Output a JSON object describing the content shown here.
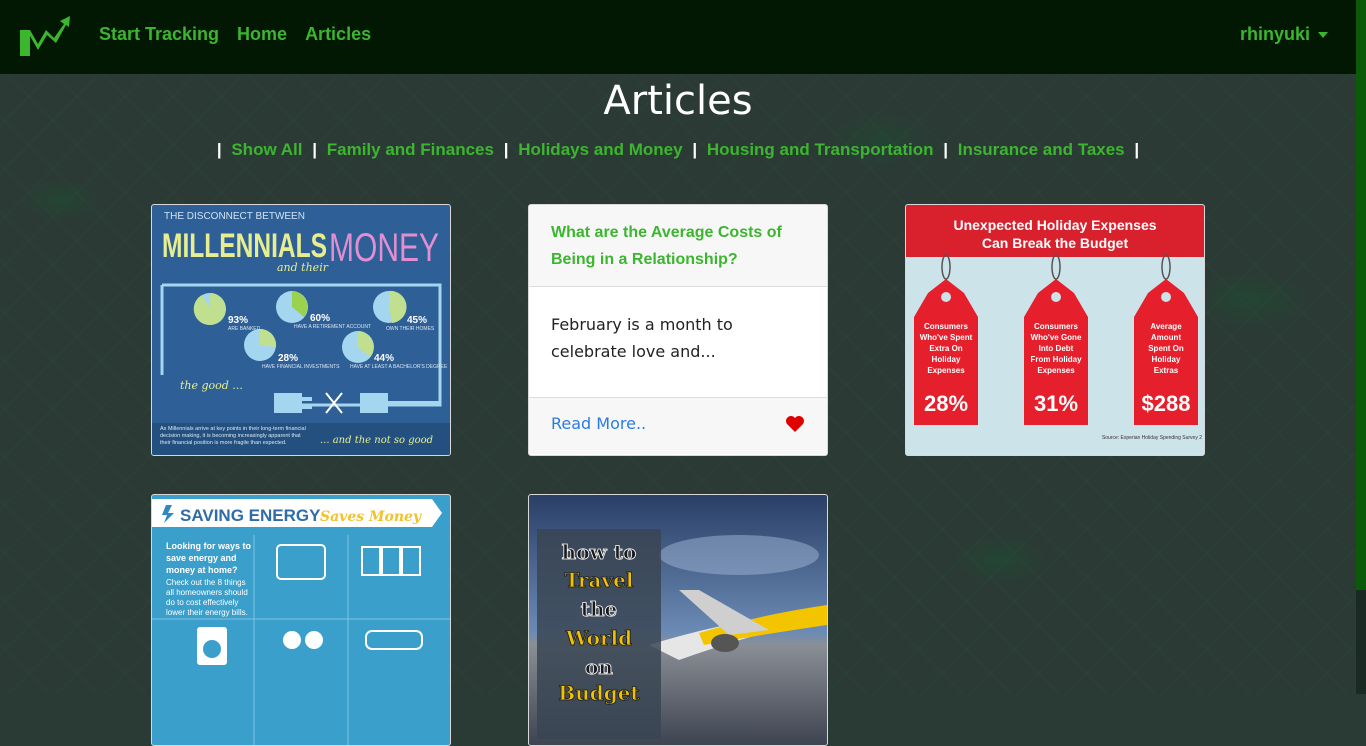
{
  "navbar": {
    "links": [
      "Start Tracking",
      "Home",
      "Articles"
    ],
    "user": "rhinyuki"
  },
  "page": {
    "title": "Articles",
    "filters": [
      "Show All",
      "Family and Finances",
      "Holidays and Money",
      "Housing and Transportation",
      "Insurance and Taxes"
    ]
  },
  "articles": {
    "millennials": {
      "line1": "THE DISCONNECT BETWEEN",
      "line2": "MILLENNIALS",
      "line3": "MONEY",
      "line4": "and their",
      "stats": [
        "93%",
        "60%",
        "45%",
        "28%",
        "44%"
      ],
      "stat_labels": [
        "ARE BANKED",
        "HAVE A RETIREMENT ACCOUNT",
        "OWN THEIR HOMES",
        "HAVE FINANCIAL INVESTMENTS",
        "HAVE AT LEAST A BACHELOR'S DEGREE"
      ],
      "good": "the good ...",
      "not_so_good": "... and the not so good",
      "text": "As Millennials arrive at key points in their long-term financial decision making, it is becoming increasingly apparent that their financial position is more fragile than expected."
    },
    "relationship": {
      "title": "What are the Average Costs of Being in a Relationship?",
      "excerpt": "February is a month to celebrate love and...",
      "read_more": "Read More.."
    },
    "holiday": {
      "title1": "Unexpected Holiday Expenses",
      "title2": "Can Break the Budget",
      "tags": [
        {
          "label": [
            "Consumers",
            "Who've Spent",
            "Extra On",
            "Holiday",
            "Expenses"
          ],
          "value": "28%"
        },
        {
          "label": [
            "Consumers",
            "Who've Gone",
            "Into Debt",
            "From Holiday",
            "Expenses"
          ],
          "value": "31%"
        },
        {
          "label": [
            "Average",
            "Amount",
            "Spent On",
            "Holiday",
            "Extras"
          ],
          "value": "$288"
        }
      ],
      "source": "Source: Experian Holiday Spending Survey 2"
    },
    "energy": {
      "title1": "SAVING ENERGY",
      "title2": "Saves Money",
      "intro": [
        "Looking for ways to",
        "save energy and",
        "money at home?",
        "Check out the 8 things",
        "all homeowners should",
        "do to cost effectively",
        "lower their energy bills."
      ]
    },
    "travel": {
      "words": [
        "how to",
        "Travel",
        "the",
        "World",
        "on",
        "Budget"
      ]
    }
  },
  "colors": {
    "accent": "#3cb52f",
    "navbar": "#021802",
    "link": "#2a7be4",
    "heart": "#e00000"
  }
}
